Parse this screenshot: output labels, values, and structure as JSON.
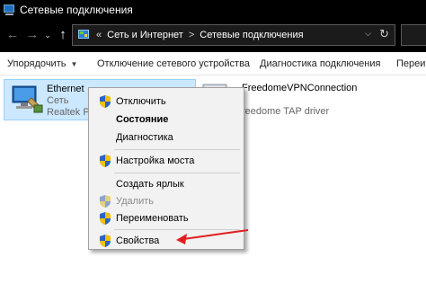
{
  "window": {
    "title": "Сетевые подключения"
  },
  "address": {
    "prefix": "«",
    "path": [
      "Сеть и Интернет",
      "Сетевые подключения"
    ],
    "separator": ">"
  },
  "nav": {
    "back": "←",
    "forward": "→",
    "recent": "⌄",
    "up": "↑"
  },
  "toolbar": {
    "organize_label": "Упорядочить",
    "disable_device_label": "Отключение сетевого устройства",
    "diagnose_label": "Диагностика подключения",
    "rename_label": "Переим"
  },
  "adapters": [
    {
      "name": "Ethernet",
      "status": "Сеть",
      "device": "Realtek PC",
      "icon": "ethernet-adapter-icon",
      "selected": true
    },
    {
      "name": "FreedomeVPNConnection",
      "status": "",
      "device": "reedome TAP driver",
      "icon": "vpn-adapter-icon",
      "selected": false
    }
  ],
  "context_menu": {
    "items": [
      {
        "label": "Отключить",
        "icon": "uac-shield-icon",
        "bold": false,
        "disabled": false
      },
      {
        "label": "Состояние",
        "icon": "",
        "bold": true,
        "disabled": false
      },
      {
        "label": "Диагностика",
        "icon": "",
        "bold": false,
        "disabled": false
      },
      {
        "label": "Настройка моста",
        "icon": "uac-shield-icon",
        "bold": false,
        "disabled": false
      },
      {
        "label": "Создать ярлык",
        "icon": "",
        "bold": false,
        "disabled": false
      },
      {
        "label": "Удалить",
        "icon": "uac-shield-icon",
        "bold": false,
        "disabled": true
      },
      {
        "label": "Переименовать",
        "icon": "uac-shield-icon",
        "bold": false,
        "disabled": false
      },
      {
        "label": "Свойства",
        "icon": "uac-shield-icon",
        "bold": false,
        "disabled": false
      }
    ]
  },
  "annotation": {
    "icon": "red-arrow-icon",
    "color": "#e02020"
  },
  "colors": {
    "selection": "#cce8ff",
    "titlebar": "#000000",
    "menu_bg": "#f2f2f2"
  }
}
